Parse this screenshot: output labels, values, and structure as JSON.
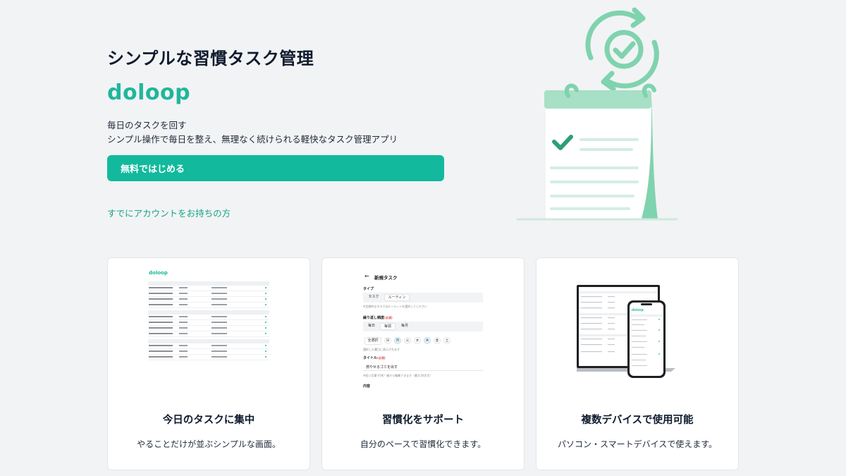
{
  "hero": {
    "tagline": "シンプルな習慣タスク管理",
    "brand": "doloop",
    "description_line1": "毎日のタスクを回す",
    "description_line2": "シンプル操作で毎日を整え、無理なく続けられる軽快なタスク管理アプリ",
    "cta_label": "無料ではじめる",
    "login_link": "すでにアカウントをお持ちの方"
  },
  "features": [
    {
      "title": "今日のタスクに集中",
      "description": "やることだけが並ぶシンプルな画面。",
      "preview_logo": "doloop"
    },
    {
      "title": "習慣化をサポート",
      "description": "自分のペースで習慣化できます。",
      "preview": {
        "header": "新規タスク",
        "type_label": "タイプ",
        "type_options": [
          "タスク",
          "ルーティン"
        ],
        "type_hint": "※定期的なタスクはルーティンを選択してください",
        "freq_label": "繰り返し頻度",
        "required": "(必須)",
        "freq_options": [
          "毎日",
          "毎週",
          "毎月"
        ],
        "select_all": "全選択",
        "days": [
          "日",
          "月",
          "火",
          "水",
          "木",
          "金",
          "土"
        ],
        "days_hint": "選択した曜日に表示されます",
        "title_label": "タイトル",
        "title_value": "燃やせるゴミを出す",
        "title_hint": "※短い言葉でOK！後から編集できます（最大30文字）",
        "content_label": "内容"
      }
    },
    {
      "title": "複数デバイスで使用可能",
      "description": "パソコン・スマートデバイスで使えます。",
      "preview_logo": "doloop"
    }
  ],
  "colors": {
    "accent": "#12b99d",
    "brand": "#1fb79b",
    "background": "#f2f3f5",
    "illustration_green": "#7fd3ae"
  },
  "icons": [
    "refresh-check-icon",
    "calendar-checklist-icon",
    "back-arrow-icon"
  ]
}
